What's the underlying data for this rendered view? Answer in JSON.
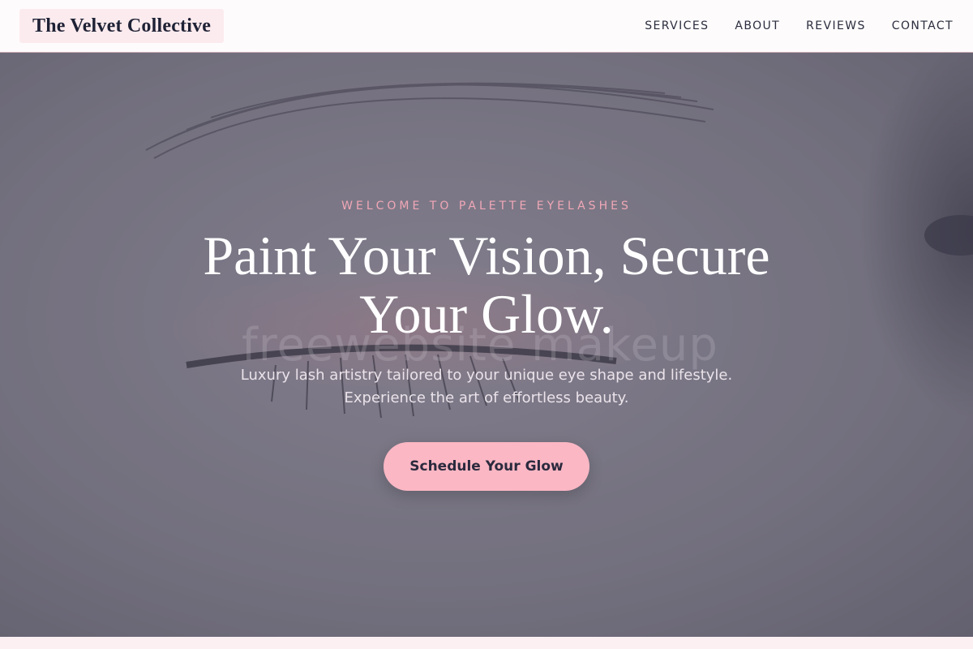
{
  "header": {
    "logo": "The Velvet Collective",
    "nav": [
      {
        "label": "SERVICES"
      },
      {
        "label": "ABOUT"
      },
      {
        "label": "REVIEWS"
      },
      {
        "label": "CONTACT"
      }
    ]
  },
  "hero": {
    "eyebrow": "WELCOME TO PALETTE EYELASHES",
    "headline": "Paint Your Vision, Secure Your Glow.",
    "subtext": "Luxury lash artistry tailored to your unique eye shape and lifestyle. Experience the art of effortless beauty.",
    "cta_label": "Schedule Your Glow",
    "watermark": "freewebsite makeup"
  },
  "colors": {
    "accent": "#fbb7c4",
    "eyebrow": "#f0a7b6",
    "header_bg": "#fefbfc",
    "text_dark": "#1f2236"
  }
}
